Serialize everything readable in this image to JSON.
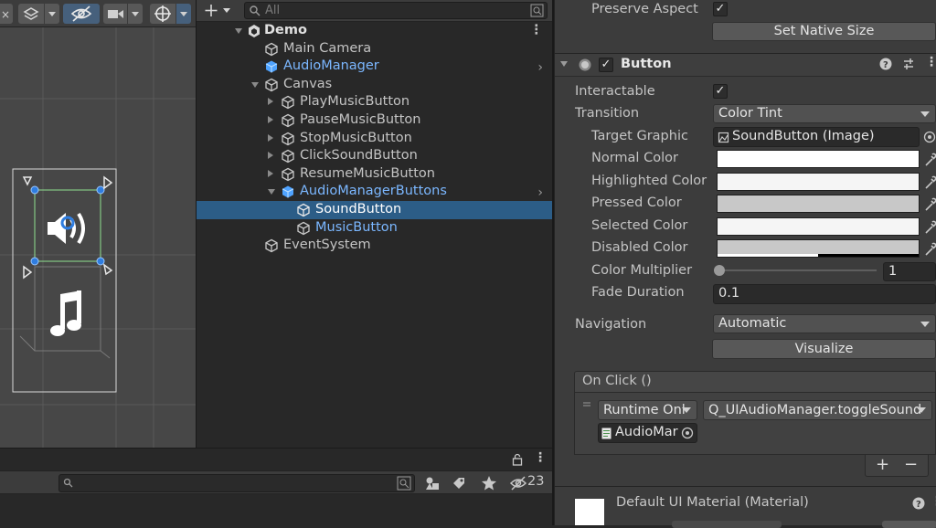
{
  "scene": {
    "toolbar_icons": [
      "close-icon",
      "layers-icon",
      "visibility-off-icon",
      "camera-icon",
      "gizmo-icon"
    ]
  },
  "hierarchy": {
    "search_placeholder": "All",
    "items": [
      {
        "label": "Demo",
        "icon": "unity-scene-icon",
        "prefab": false
      },
      {
        "label": "Main Camera",
        "icon": "cube-outline-icon",
        "prefab": false
      },
      {
        "label": "AudioManager",
        "icon": "prefab-cube-icon",
        "prefab": true
      },
      {
        "label": "Canvas",
        "icon": "cube-outline-icon",
        "prefab": false
      },
      {
        "label": "PlayMusicButton",
        "icon": "cube-outline-icon",
        "prefab": false
      },
      {
        "label": "PauseMusicButton",
        "icon": "cube-outline-icon",
        "prefab": false
      },
      {
        "label": "StopMusicButton",
        "icon": "cube-outline-icon",
        "prefab": false
      },
      {
        "label": "ClickSoundButton",
        "icon": "cube-outline-icon",
        "prefab": false
      },
      {
        "label": "ResumeMusicButton",
        "icon": "cube-outline-icon",
        "prefab": false
      },
      {
        "label": "AudioManagerButtons",
        "icon": "prefab-cube-icon",
        "prefab": true
      },
      {
        "label": "SoundButton",
        "icon": "cube-outline-icon",
        "prefab": false
      },
      {
        "label": "MusicButton",
        "icon": "cube-outline-icon",
        "prefab": false
      },
      {
        "label": "EventSystem",
        "icon": "cube-outline-icon",
        "prefab": false
      }
    ],
    "selected_index": 10
  },
  "project": {
    "hidden_count": "23"
  },
  "inspector": {
    "preserve_aspect_label": "Preserve Aspect",
    "preserve_aspect_checked": "✓",
    "set_native_size_label": "Set Native Size",
    "component_title": "Button",
    "component_enabled": "✓",
    "interactable_label": "Interactable",
    "interactable_checked": "✓",
    "transition_label": "Transition",
    "transition_value": "Color Tint",
    "target_graphic_label": "Target Graphic",
    "target_graphic_value": "SoundButton (Image)",
    "colors": [
      {
        "label": "Normal Color",
        "hex": "#ffffff"
      },
      {
        "label": "Highlighted Color",
        "hex": "#f5f5f5"
      },
      {
        "label": "Pressed Color",
        "hex": "#c8c8c8"
      },
      {
        "label": "Selected Color",
        "hex": "#f5f5f5"
      },
      {
        "label": "Disabled Color",
        "hex": "#c8c8c8"
      }
    ],
    "color_multiplier_label": "Color Multiplier",
    "color_multiplier_value": "1",
    "fade_duration_label": "Fade Duration",
    "fade_duration_value": "0.1",
    "navigation_label": "Navigation",
    "navigation_value": "Automatic",
    "visualize_label": "Visualize",
    "onclick_header": "On Click ()",
    "onclick_runtime": "Runtime Onl",
    "onclick_function": "Q_UIAudioManager.toggleSound",
    "onclick_object": "AudioMar",
    "add_label": "+",
    "remove_label": "−",
    "material_title": "Default UI Material (Material)"
  }
}
